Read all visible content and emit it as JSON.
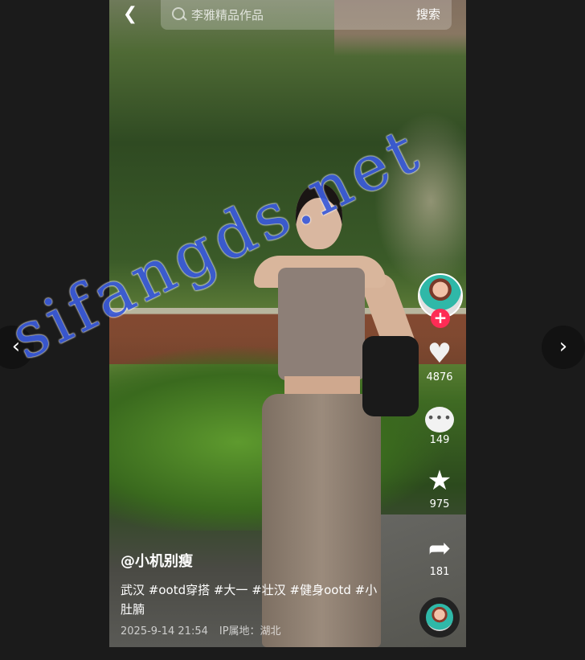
{
  "top_bar": {
    "back_icon": "chevron-left-icon",
    "search_placeholder": "李雅精品作品",
    "search_button": "搜索"
  },
  "actions": {
    "likes": "4876",
    "comments": "149",
    "favorites": "975",
    "shares": "181"
  },
  "post": {
    "author": "@小机别瘦",
    "description": "武汉 #ootd穿搭 #大一 #壮汉 #健身ootd #小肚腩",
    "datetime": "2025-9-14 21:54",
    "ip_location": "IP属地：湖北"
  },
  "nav": {
    "prev_icon": "‹",
    "next_icon": "›"
  },
  "watermark": "sifangds.net",
  "colors": {
    "accent_red": "#fe2c55",
    "watermark_blue": "#3b5bdb"
  }
}
